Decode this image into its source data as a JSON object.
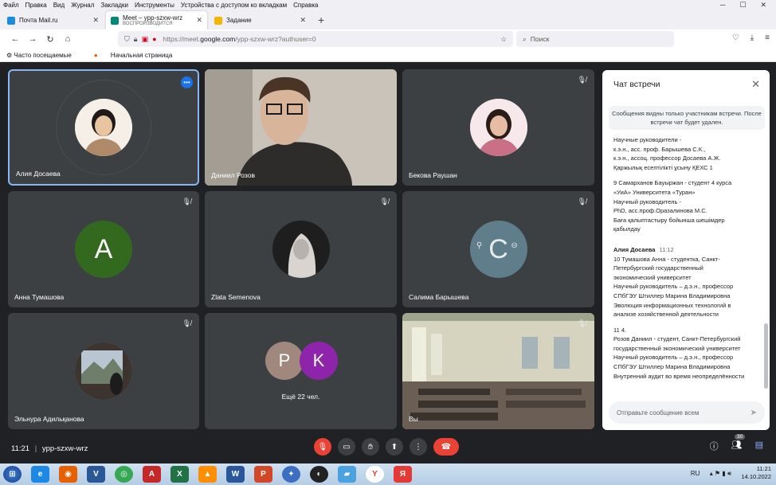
{
  "menu": [
    "Файл",
    "Правка",
    "Вид",
    "Журнал",
    "Закладки",
    "Инструменты",
    "Устройства с доступом ко вкладкам",
    "Справка"
  ],
  "tabs": [
    {
      "label": "Почта Mail.ru",
      "sub": "",
      "color": "#168de2"
    },
    {
      "label": "Meet – ypp-szxw-wrz",
      "sub": "ВОСПРОИЗВОДИТСЯ",
      "color": "#00897b"
    },
    {
      "label": "Задание",
      "sub": "",
      "color": "#f4b400"
    }
  ],
  "url": {
    "prefix": "https://meet.",
    "domain": "google.com",
    "path": "/ypp-szxw-wrz?authuser=0"
  },
  "search_placeholder": "Поиск",
  "bookmarks": [
    "Часто посещаемые",
    "Начальная страница"
  ],
  "participants": [
    {
      "name": "Алия Досаева",
      "type": "photo",
      "color": "#c4a484",
      "active": true
    },
    {
      "name": "Даниил Розов",
      "type": "video",
      "color": "#b9b3a9"
    },
    {
      "name": "Бекова Раушан",
      "type": "photo",
      "color": "#d9a7b0"
    },
    {
      "name": "Анна Тумашова",
      "type": "letter",
      "letter": "A",
      "color": "#33691e"
    },
    {
      "name": "Zlata Semenova",
      "type": "photo",
      "color": "#555555"
    },
    {
      "name": "Салима Барышева",
      "type": "letter",
      "letter": "C",
      "color": "#607d8b"
    },
    {
      "name": "Эльнура Адильқанова",
      "type": "photo",
      "color": "#8d9aa5"
    },
    {
      "name": "",
      "type": "more",
      "more_text": "Ещё 22 чел.",
      "letters": [
        "P",
        "K"
      ],
      "colors": [
        "#a1887f",
        "#8e24aa"
      ]
    },
    {
      "name": "Вы",
      "type": "video",
      "color": "#c8c6b0"
    }
  ],
  "chat": {
    "title": "Чат встречи",
    "note": "Сообщения видны только участникам встречи. После встречи чат будет удален.",
    "lines_a": [
      "Научные руководители -",
      "к.э.н., асс. проф.  Барышева С.К.,",
      "к.э.н., ассоц. профессор  Досаева А.Ж.",
      "Қаржылық есептілікті ұсыну ҚЕХС 1"
    ],
    "lines_b": [
      "9 Самарханов Бауыржан  - студент 4 курса",
      "«УиА» Университета «Туран»",
      "Научный руководитель -",
      " PhD, асс.проф.Оразалинова М.С.",
      "Баға қалыптастыру бойынша шешімдер",
      "қабылдау"
    ],
    "sender": "Алия Досаева",
    "sender_time": "11:12",
    "lines_c": [
      "10 Тумашова Анна - студентка, Санкт-",
      "Петербургский государственный",
      "экономический университет",
      "Научный руководитель – д.э.н., профессор",
      "СПбГЭУ  Штиллер Марина Владимировна",
      "Эволюция информационных технологий в",
      "анализе хозяйственной деятельности"
    ],
    "lines_d": [
      "11      4.",
      "Розов Даниил - студент, Санкт-Петербургский",
      "государственный экономический университет",
      "Научный руководитель – д.э.н., профессор",
      "СПбГЭУ  Штиллер Марина Владимировна",
      "Внутренний аудит во время неопределённости"
    ],
    "input_placeholder": "Отправьте сообщение всем"
  },
  "meeting": {
    "time": "11:21",
    "code": "ypp-szxw-wrz",
    "people_badge": "30"
  },
  "taskbar": {
    "lang": "RU",
    "time": "11:21",
    "date": "14.10.2022"
  }
}
